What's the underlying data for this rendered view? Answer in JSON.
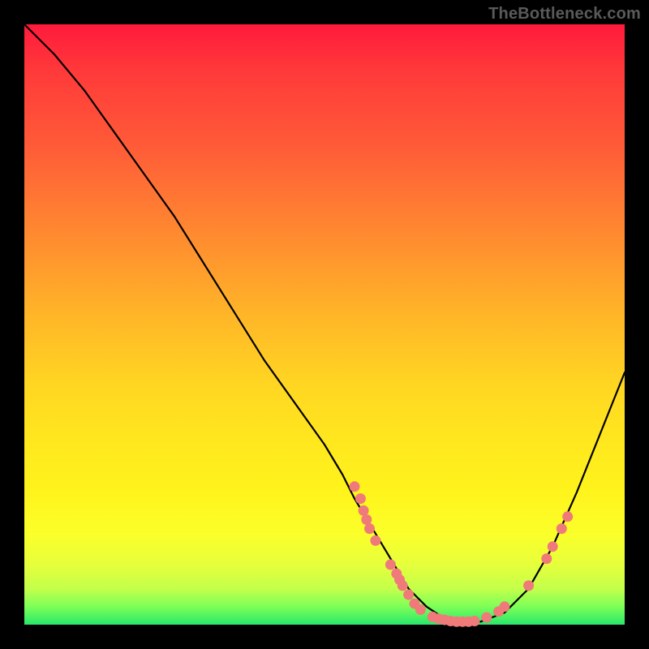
{
  "watermark": "TheBottleneck.com",
  "chart_data": {
    "type": "line",
    "title": "",
    "xlabel": "",
    "ylabel": "",
    "xlim": [
      0,
      100
    ],
    "ylim": [
      0,
      100
    ],
    "series": [
      {
        "name": "bottleneck-curve",
        "x": [
          0,
          5,
          10,
          15,
          20,
          25,
          30,
          35,
          40,
          45,
          50,
          53,
          55,
          58,
          61,
          64,
          67,
          70,
          73,
          76,
          80,
          84,
          88,
          92,
          96,
          100
        ],
        "y": [
          100,
          95,
          89,
          82,
          75,
          68,
          60,
          52,
          44,
          37,
          30,
          25,
          21,
          16,
          11,
          6,
          3,
          1,
          0.5,
          0.5,
          2,
          6,
          13,
          22,
          32,
          42
        ]
      }
    ],
    "highlight_points": {
      "name": "cluster-dots",
      "color": "#f07a7a",
      "points": [
        {
          "x": 55,
          "y": 23
        },
        {
          "x": 56,
          "y": 21
        },
        {
          "x": 56.5,
          "y": 19
        },
        {
          "x": 57,
          "y": 17.5
        },
        {
          "x": 57.5,
          "y": 16
        },
        {
          "x": 58.5,
          "y": 14
        },
        {
          "x": 61,
          "y": 10
        },
        {
          "x": 62,
          "y": 8.5
        },
        {
          "x": 62.5,
          "y": 7.5
        },
        {
          "x": 63,
          "y": 6.5
        },
        {
          "x": 64,
          "y": 5
        },
        {
          "x": 65,
          "y": 3.5
        },
        {
          "x": 66,
          "y": 2.5
        },
        {
          "x": 68,
          "y": 1.3
        },
        {
          "x": 69,
          "y": 1.0
        },
        {
          "x": 70,
          "y": 0.8
        },
        {
          "x": 71,
          "y": 0.6
        },
        {
          "x": 72,
          "y": 0.5
        },
        {
          "x": 73,
          "y": 0.5
        },
        {
          "x": 74,
          "y": 0.5
        },
        {
          "x": 75,
          "y": 0.6
        },
        {
          "x": 77,
          "y": 1.2
        },
        {
          "x": 79,
          "y": 2.2
        },
        {
          "x": 80,
          "y": 3.0
        },
        {
          "x": 84,
          "y": 6.5
        },
        {
          "x": 87,
          "y": 11
        },
        {
          "x": 88,
          "y": 13
        },
        {
          "x": 89.5,
          "y": 16
        },
        {
          "x": 90.5,
          "y": 18
        }
      ]
    }
  }
}
